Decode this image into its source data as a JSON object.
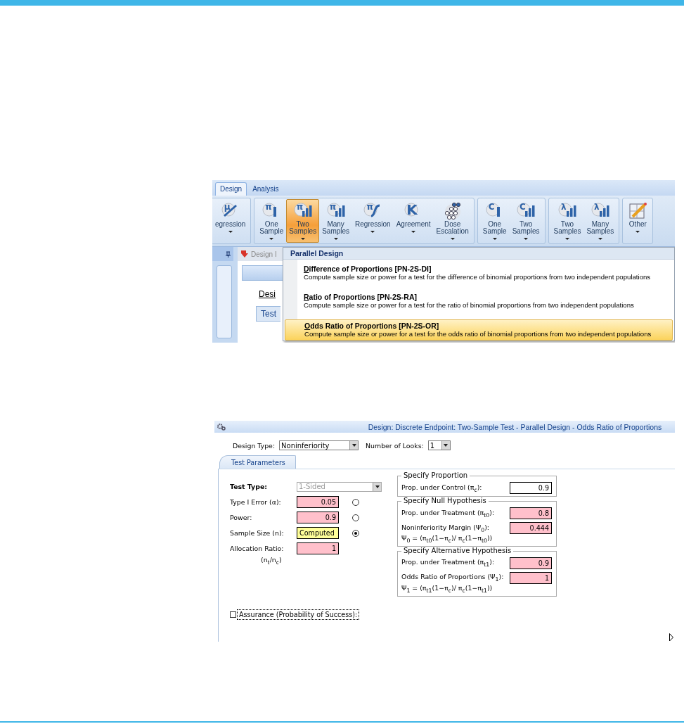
{
  "ribbon": {
    "tabs": [
      {
        "label": "Design",
        "selected": true
      },
      {
        "label": "Analysis",
        "selected": false
      }
    ],
    "groups": [
      {
        "buttons": [
          {
            "label": "egression",
            "glyph": "μ",
            "kind": "line",
            "selected": false
          }
        ]
      },
      {
        "buttons": [
          {
            "label": "One\nSample",
            "glyph": "π",
            "kind": "bar",
            "selected": false
          },
          {
            "label": "Two\nSamples",
            "glyph": "π",
            "kind": "bars",
            "selected": true
          },
          {
            "label": "Many\nSamples",
            "glyph": "π",
            "kind": "bars",
            "selected": false
          },
          {
            "label": "Regression",
            "glyph": "π",
            "kind": "curve",
            "selected": false
          },
          {
            "label": "Agreement",
            "glyph": "K",
            "kind": "letter",
            "selected": false
          },
          {
            "label": "Dose\nEscalation",
            "kind": "dots",
            "selected": false
          }
        ]
      },
      {
        "buttons": [
          {
            "label": "One\nSample",
            "glyph": "C",
            "kind": "bar",
            "selected": false
          },
          {
            "label": "Two\nSamples",
            "glyph": "C",
            "kind": "bars",
            "selected": false
          }
        ]
      },
      {
        "buttons": [
          {
            "label": "Two\nSamples",
            "glyph": "λ",
            "kind": "bars",
            "selected": false
          },
          {
            "label": "Many\nSamples",
            "glyph": "λ",
            "kind": "bars",
            "selected": false
          }
        ]
      },
      {
        "buttons": [
          {
            "label": "Other",
            "kind": "pencil",
            "selected": false
          }
        ]
      }
    ]
  },
  "side_panel": {
    "tab": "Design I",
    "label": "Desi",
    "subtab": "Test"
  },
  "menu": {
    "header": "Parallel Design",
    "items": [
      {
        "title": "Difference of Proportions [PN-2S-DI]",
        "description": "Compute sample size or power for a test for the difference of binomial proportions from two independent populations",
        "selected": false
      },
      {
        "title": "Ratio of Proportions [PN-2S-RA]",
        "description": "Compute sample size or power for a test for the ratio of binomial proportions from two independent populations",
        "selected": false
      },
      {
        "title": "Odds Ratio of Proportions [PN-2S-OR]",
        "description": "Compute sample size or power for a test for the odds ratio of binomial proportions from two independent populations",
        "selected": true
      }
    ]
  },
  "form": {
    "title": "Design: Discrete Endpoint: Two-Sample Test - Parallel Design - Odds Ratio of Proportions",
    "design_type": {
      "label": "Design Type:",
      "value": "Noninferiority"
    },
    "looks": {
      "label": "Number of Looks:",
      "value": "1"
    },
    "tab": "Test Parameters",
    "test_type": {
      "label": "Test Type:",
      "value": "1-Sided",
      "disabled": true
    },
    "parameters": [
      {
        "label": "Type I Error (α):",
        "value": "0.05",
        "kind": "entry",
        "selected": false
      },
      {
        "label": "Power:",
        "value": "0.9",
        "kind": "entry",
        "selected": false
      },
      {
        "label": "Sample Size (n):",
        "value": "Computed",
        "kind": "computed",
        "selected": true
      },
      {
        "label": "Allocation Ratio:",
        "value": "1",
        "kind": "entry",
        "note": "(n$_{t}$/n$_{c}$)"
      }
    ],
    "groups": [
      {
        "title": "Specify Proportion",
        "fields": [
          {
            "label": "Prop. under Control (π$_{c}$):",
            "value": "0.9",
            "kind": "plain"
          }
        ]
      },
      {
        "title": "Specify Null Hypothesis",
        "fields": [
          {
            "label": "Prop. under Treatment (π$_{t0}$):",
            "value": "0.8",
            "kind": "entry"
          },
          {
            "label": "Noninferiority Margin (Ψ$_{0}$):",
            "value": "0.444",
            "kind": "entry"
          }
        ],
        "formula": "Ψ$_{0}$ = (π$_{t0}$(1−π$_{c}$)/ π$_{c}$(1−π$_{t0}$))"
      },
      {
        "title": "Specify Alternative Hypothesis",
        "fields": [
          {
            "label": "Prop. under Treatment (π$_{t1}$):",
            "value": "0.9",
            "kind": "entry"
          },
          {
            "label": "Odds Ratio of Proportions (Ψ$_{1}$):",
            "value": "1",
            "kind": "entry"
          }
        ],
        "formula": "Ψ$_{1}$ = (π$_{t1}$(1−π$_{c}$)/ π$_{c}$(1−π$_{t1}$))"
      }
    ],
    "assurance": {
      "label": "Assurance (Probability of Success):",
      "checked": false
    }
  }
}
